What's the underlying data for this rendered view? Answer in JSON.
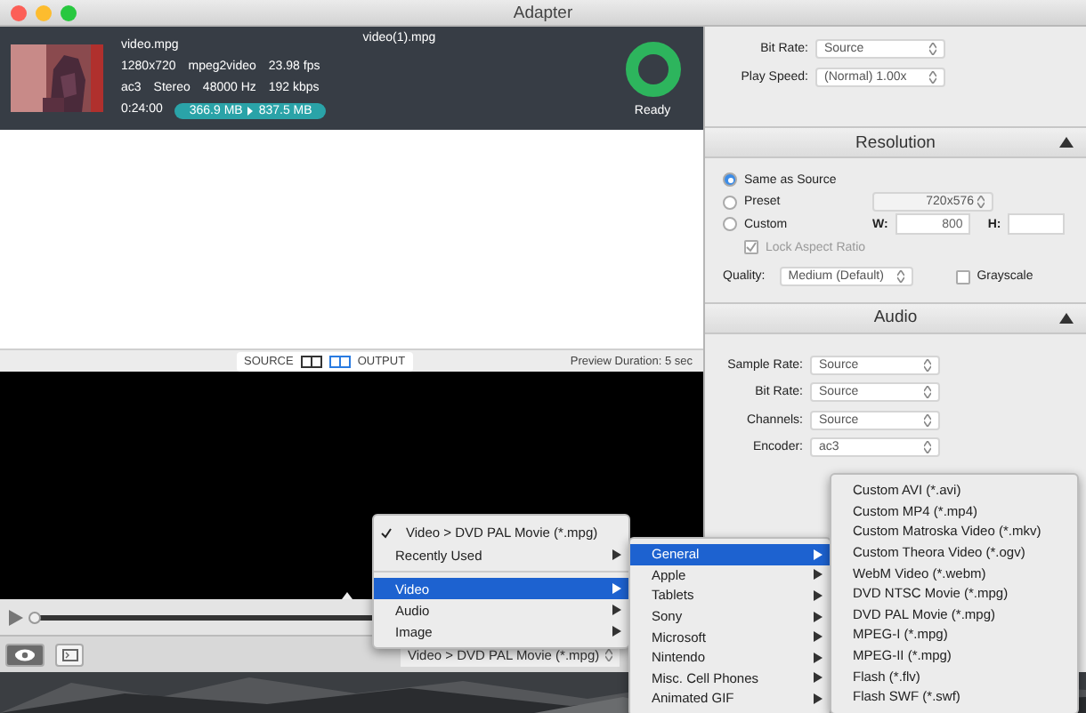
{
  "window": {
    "title": "Adapter"
  },
  "file": {
    "name": "video.mpg",
    "output_name": "video(1).mpg",
    "video_info": [
      "1280x720",
      "mpeg2video",
      "23.98 fps"
    ],
    "audio_info": [
      "ac3",
      "Stereo",
      "48000 Hz",
      "192 kbps"
    ],
    "duration": "0:24:00",
    "size_from": "366.9 MB",
    "size_to": "837.5 MB",
    "status": "Ready"
  },
  "preview_toolbar": {
    "source_label": "SOURCE",
    "output_label": "OUTPUT",
    "views": [
      {
        "selected": false
      },
      {
        "selected": true
      }
    ],
    "duration": "Preview Duration: 5 sec"
  },
  "seek": {
    "level": 0
  },
  "format_select": "Video > DVD PAL Movie (*.mpg)",
  "settings": {
    "top_fields": [
      {
        "label": "Bit Rate:",
        "value": "Source"
      },
      {
        "label": "Play Speed:",
        "value": "(Normal) 1.00x"
      }
    ],
    "resolution": {
      "title": "Resolution",
      "options": [
        {
          "label": "Same as Source",
          "selected": true
        },
        {
          "label": "Preset",
          "selected": false
        },
        {
          "label": "Custom",
          "selected": false
        }
      ],
      "preset_value": "720x576",
      "width_label": "W:",
      "width_value": "800",
      "height_label": "H:",
      "lock": {
        "label": "Lock Aspect Ratio",
        "checked": true
      },
      "quality_label": "Quality:",
      "quality_value": "Medium (Default)",
      "grayscale": {
        "label": "Grayscale",
        "checked": false
      }
    },
    "audio": {
      "title": "Audio",
      "fields": [
        {
          "label": "Sample Rate:",
          "value": "Source"
        },
        {
          "label": "Bit Rate:",
          "value": "Source"
        },
        {
          "label": "Channels:",
          "value": "Source"
        },
        {
          "label": "Encoder:",
          "value": "ac3"
        }
      ]
    }
  },
  "menu": {
    "items": [
      {
        "kind": "check",
        "label": "Video > DVD PAL Movie (*.mpg)",
        "checked": true
      },
      {
        "kind": "submenu",
        "label": "Recently Used",
        "selected": false
      },
      {
        "kind": "separator"
      },
      {
        "kind": "submenu",
        "label": "Video",
        "selected": true
      },
      {
        "kind": "submenu",
        "label": "Audio",
        "selected": false
      },
      {
        "kind": "submenu",
        "label": "Image",
        "selected": false
      }
    ]
  },
  "submenu": {
    "items": [
      {
        "label": "General",
        "selected": true
      },
      {
        "label": "Apple",
        "selected": false
      },
      {
        "label": "Tablets",
        "selected": false
      },
      {
        "label": "Sony",
        "selected": false
      },
      {
        "label": "Microsoft",
        "selected": false
      },
      {
        "label": "Nintendo",
        "selected": false
      },
      {
        "label": "Misc. Cell Phones",
        "selected": false
      },
      {
        "label": "Animated GIF",
        "selected": false
      }
    ]
  },
  "formats": [
    "Custom AVI (*.avi)",
    "Custom MP4 (*.mp4)",
    "Custom Matroska Video (*.mkv)",
    "Custom Theora Video (*.ogv)",
    "WebM Video (*.webm)",
    "DVD NTSC Movie (*.mpg)",
    "DVD PAL Movie (*.mpg)",
    "MPEG-I (*.mpg)",
    "MPEG-II (*.mpg)",
    "Flash (*.flv)",
    "Flash SWF (*.swf)"
  ]
}
